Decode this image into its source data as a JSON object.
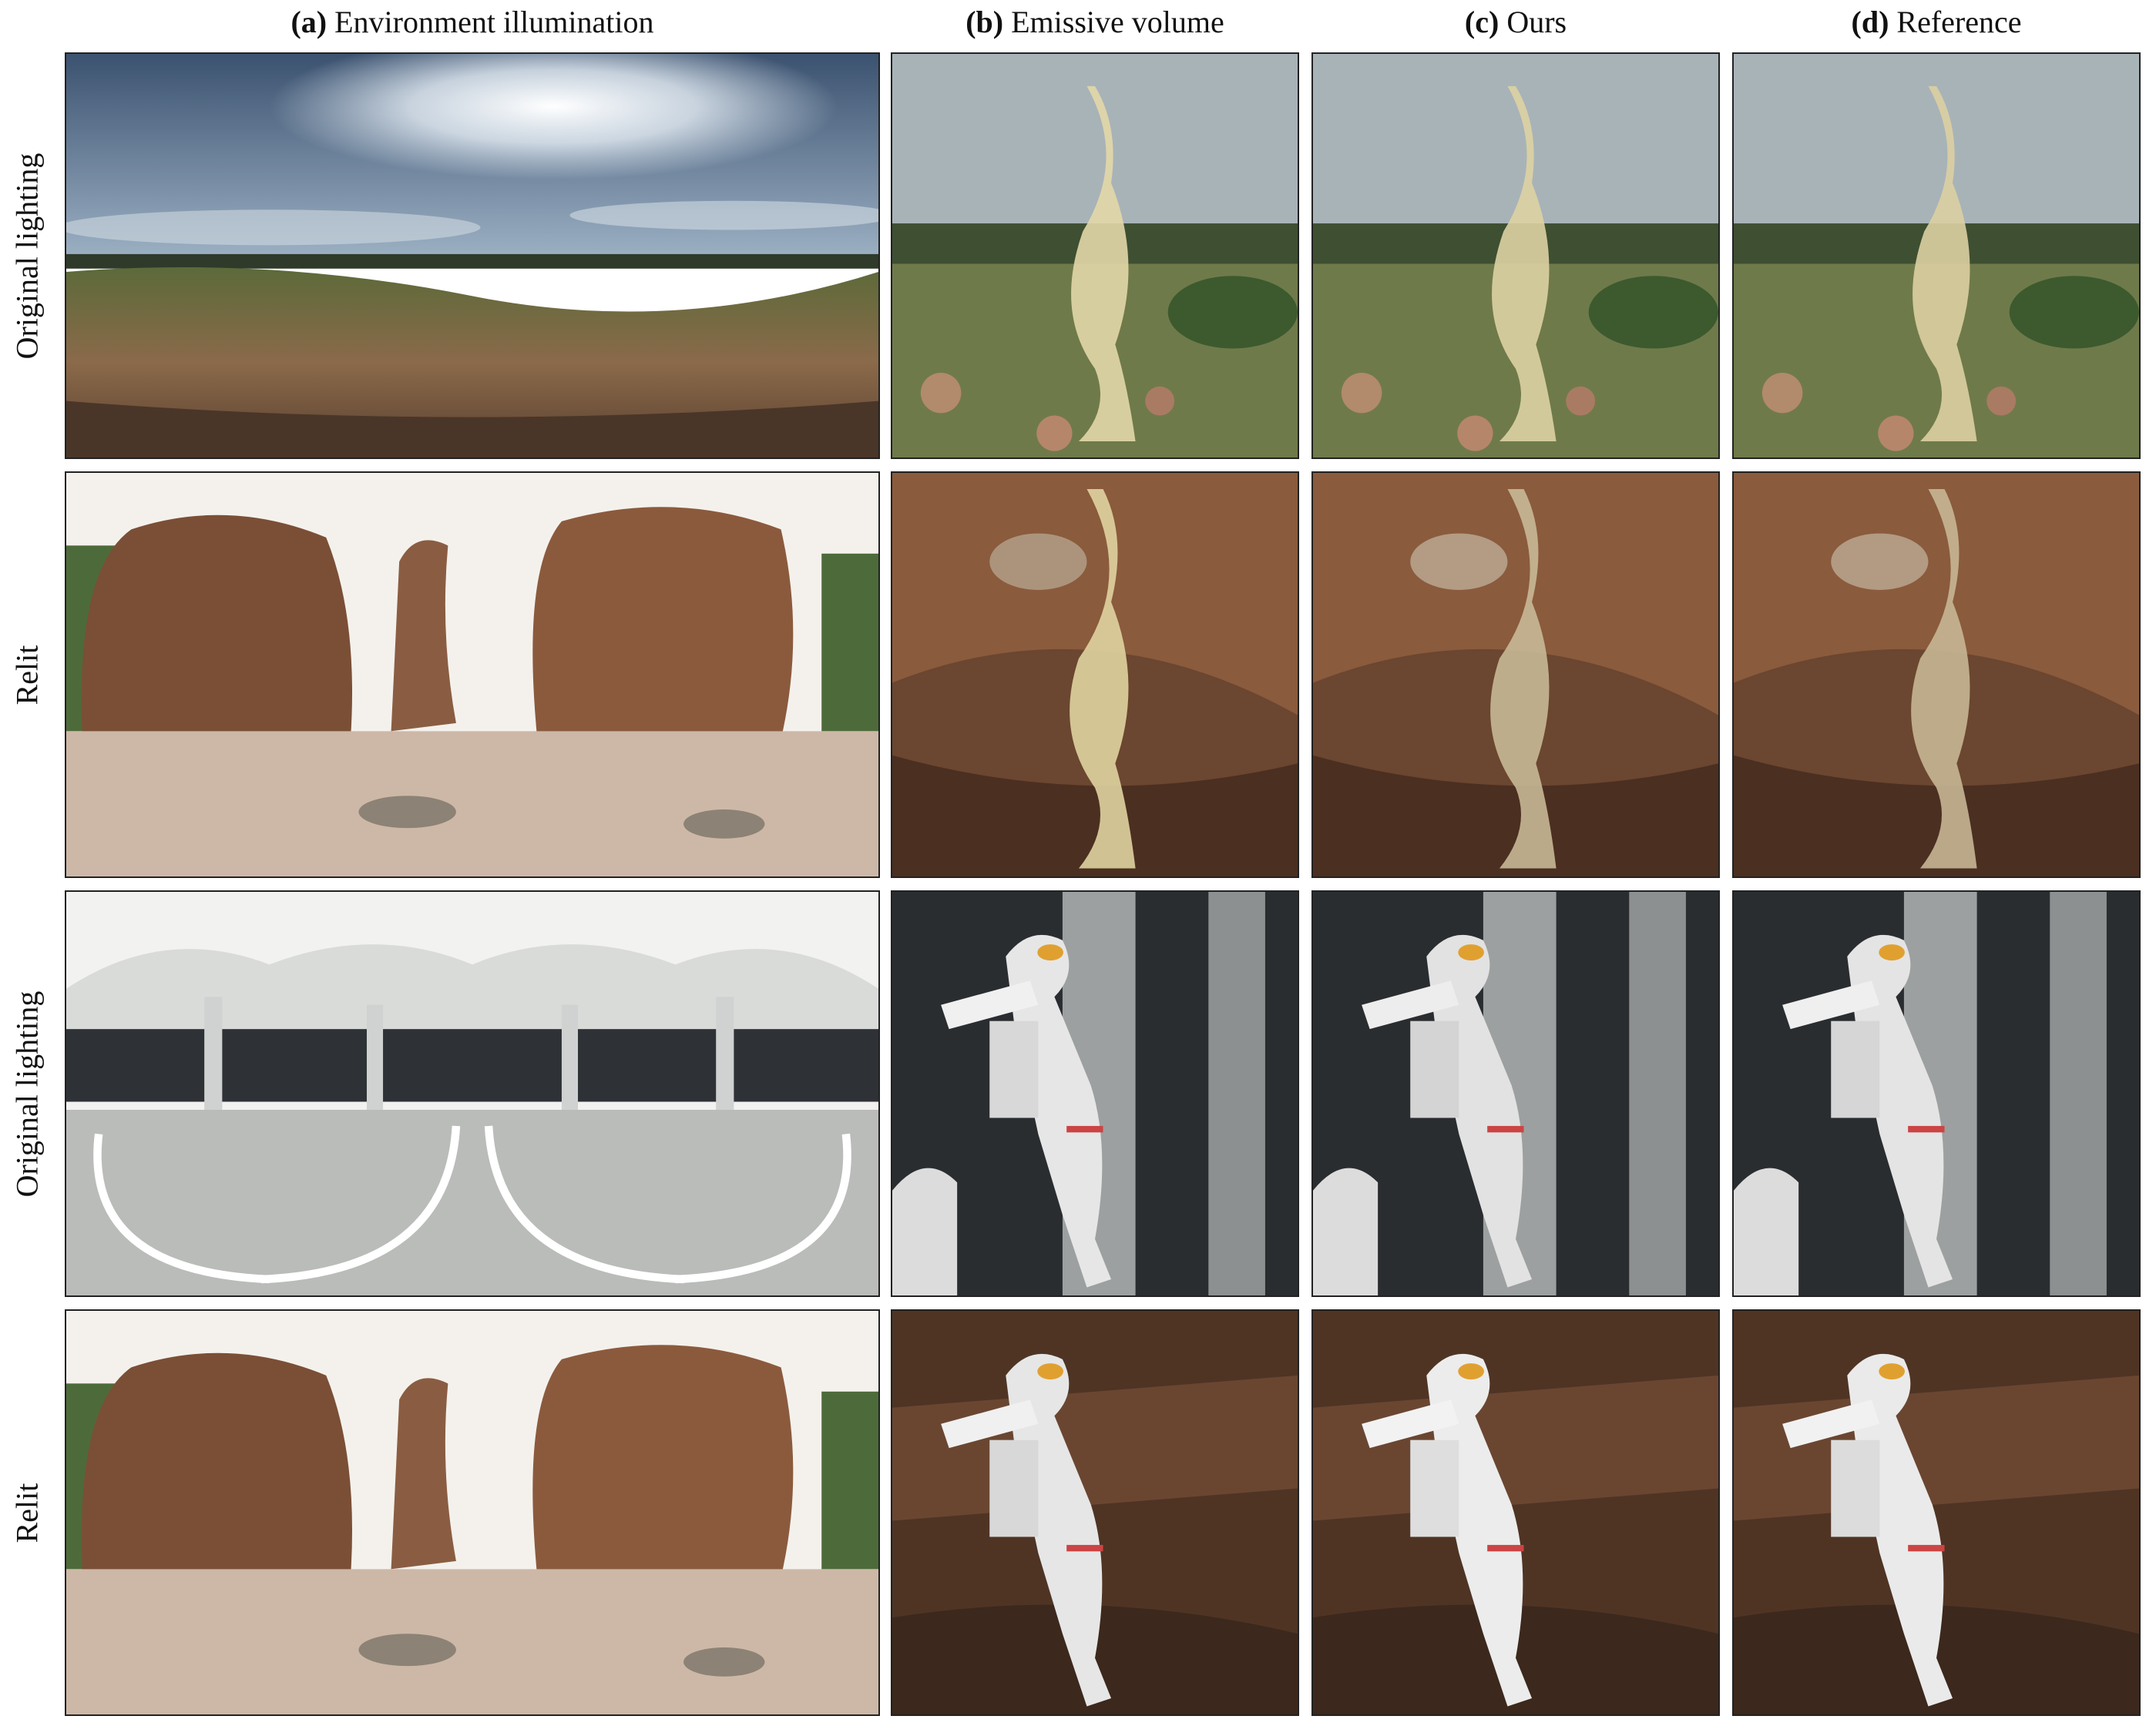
{
  "columns": [
    {
      "tag": "(a)",
      "label": "Environment illumination"
    },
    {
      "tag": "(b)",
      "label": "Emissive volume"
    },
    {
      "tag": "(c)",
      "label": "Ours"
    },
    {
      "tag": "(d)",
      "label": "Reference"
    }
  ],
  "rows": [
    {
      "label": "Original lighting",
      "scene": "hillside",
      "object": "smoke"
    },
    {
      "label": "Relit",
      "scene": "rocks",
      "object": "smoke"
    },
    {
      "label": "Original lighting",
      "scene": "garage",
      "object": "astronaut"
    },
    {
      "label": "Relit",
      "scene": "rocks",
      "object": "astronaut"
    }
  ]
}
